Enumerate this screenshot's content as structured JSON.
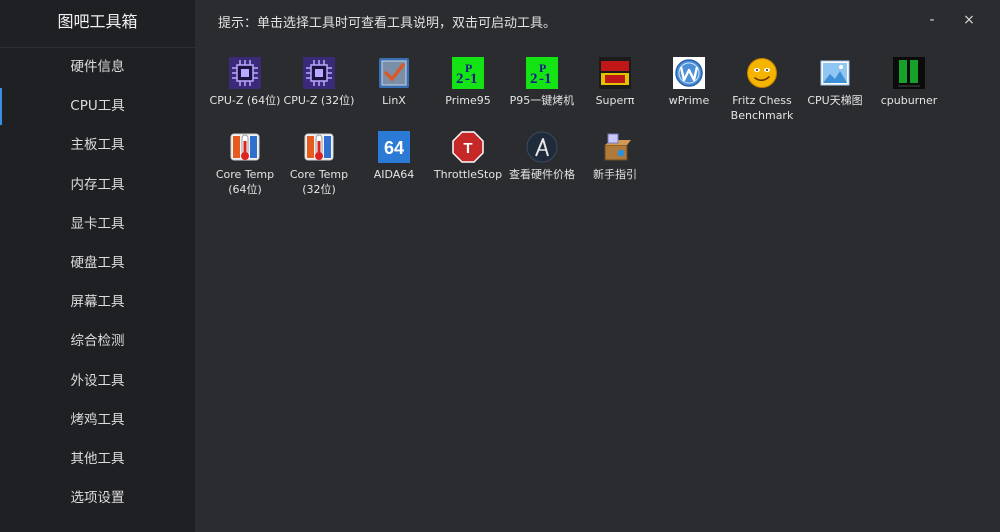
{
  "app": {
    "title": "图吧工具箱",
    "hint": "提示：单击选择工具时可查看工具说明，双击可启动工具。"
  },
  "window": {
    "minimize": "-",
    "close": "×"
  },
  "sidebar": {
    "items": [
      {
        "label": "硬件信息"
      },
      {
        "label": "CPU工具",
        "active": true
      },
      {
        "label": "主板工具"
      },
      {
        "label": "内存工具"
      },
      {
        "label": "显卡工具"
      },
      {
        "label": "硬盘工具"
      },
      {
        "label": "屏幕工具"
      },
      {
        "label": "综合检测"
      },
      {
        "label": "外设工具"
      },
      {
        "label": "烤鸡工具"
      },
      {
        "label": "其他工具"
      },
      {
        "label": "选项设置"
      }
    ]
  },
  "tools": [
    {
      "label": "CPU-Z (64位)",
      "icon": "cpu-z-icon"
    },
    {
      "label": "CPU-Z (32位)",
      "icon": "cpu-z-icon"
    },
    {
      "label": "LinX",
      "icon": "linx-icon"
    },
    {
      "label": "Prime95",
      "icon": "prime95-icon"
    },
    {
      "label": "P95一键烤机",
      "icon": "prime95-icon"
    },
    {
      "label": "Superπ",
      "icon": "superpi-icon"
    },
    {
      "label": "wPrime",
      "icon": "wprime-icon"
    },
    {
      "label": "Fritz Chess Benchmark",
      "icon": "fritz-smiley-icon"
    },
    {
      "label": "CPU天梯图",
      "icon": "picture-icon"
    },
    {
      "label": "cpuburner",
      "icon": "cpuburner-icon"
    },
    {
      "label": "Core Temp (64位)",
      "icon": "thermometer-icon"
    },
    {
      "label": "Core Temp (32位)",
      "icon": "thermometer-icon"
    },
    {
      "label": "AIDA64",
      "icon": "aida64-icon"
    },
    {
      "label": "ThrottleStop",
      "icon": "stop-sign-icon"
    },
    {
      "label": "查看硬件价格",
      "icon": "price-check-icon"
    },
    {
      "label": "新手指引",
      "icon": "guide-box-icon"
    }
  ],
  "colors": {
    "sidebar_bg": "#1f2023",
    "main_bg": "#2b2c30",
    "accent": "#3b8ee6"
  }
}
